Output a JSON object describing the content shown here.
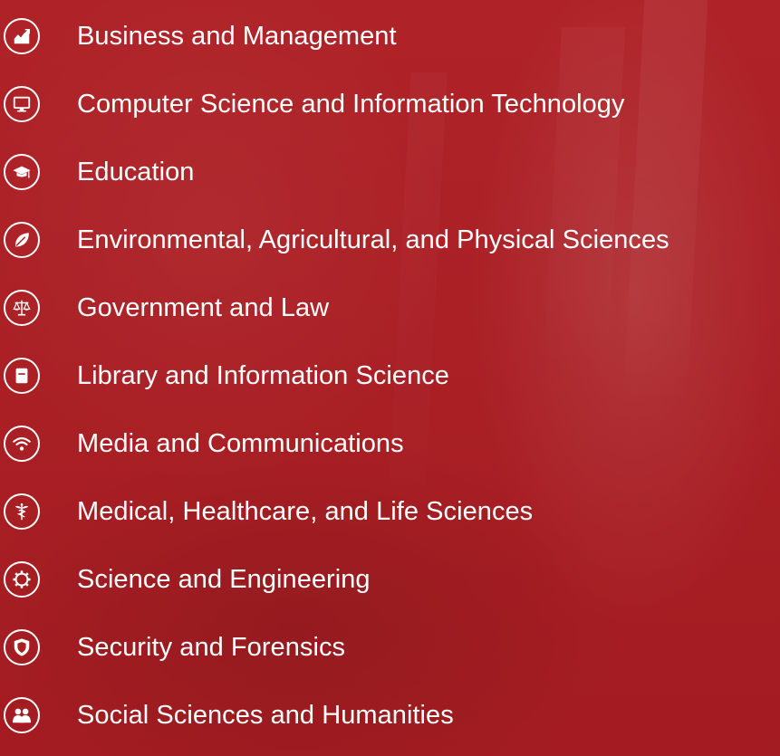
{
  "categories": [
    {
      "label": "Business and Management",
      "icon": "chart-icon"
    },
    {
      "label": "Computer Science and Information Technology",
      "icon": "monitor-icon"
    },
    {
      "label": "Education",
      "icon": "graduation-cap-icon"
    },
    {
      "label": "Environmental, Agricultural, and Physical Sciences",
      "icon": "leaf-icon"
    },
    {
      "label": "Government and Law",
      "icon": "scales-icon"
    },
    {
      "label": "Library and Information Science",
      "icon": "book-icon"
    },
    {
      "label": "Media and Communications",
      "icon": "wifi-icon"
    },
    {
      "label": "Medical, Healthcare, and Life Sciences",
      "icon": "caduceus-icon"
    },
    {
      "label": "Science and Engineering",
      "icon": "gear-icon"
    },
    {
      "label": "Security and Forensics",
      "icon": "shield-icon"
    },
    {
      "label": "Social Sciences and Humanities",
      "icon": "people-icon"
    }
  ],
  "colors": {
    "background": "#a91f24",
    "foreground": "#ffffff"
  }
}
